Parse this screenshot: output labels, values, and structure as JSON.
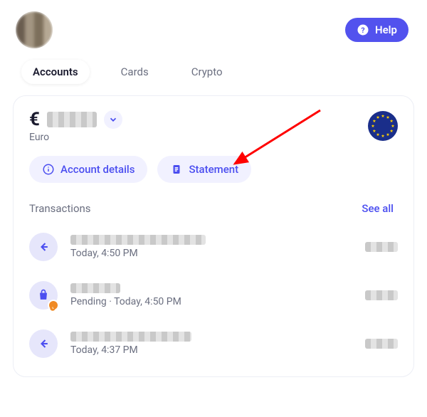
{
  "header": {
    "help_label": "Help"
  },
  "tabs": {
    "items": [
      "Accounts",
      "Cards",
      "Crypto"
    ],
    "active_index": 0
  },
  "account": {
    "currency_symbol": "€",
    "currency_name": "Euro",
    "account_details_label": "Account details",
    "statement_label": "Statement"
  },
  "transactions": {
    "title": "Transactions",
    "see_all_label": "See all",
    "items": [
      {
        "kind": "incoming",
        "subline": "Today, 4:50 PM"
      },
      {
        "kind": "purchase_pending",
        "subline": "Pending · Today, 4:50 PM"
      },
      {
        "kind": "incoming",
        "subline": "Today, 4:37 PM"
      }
    ]
  }
}
